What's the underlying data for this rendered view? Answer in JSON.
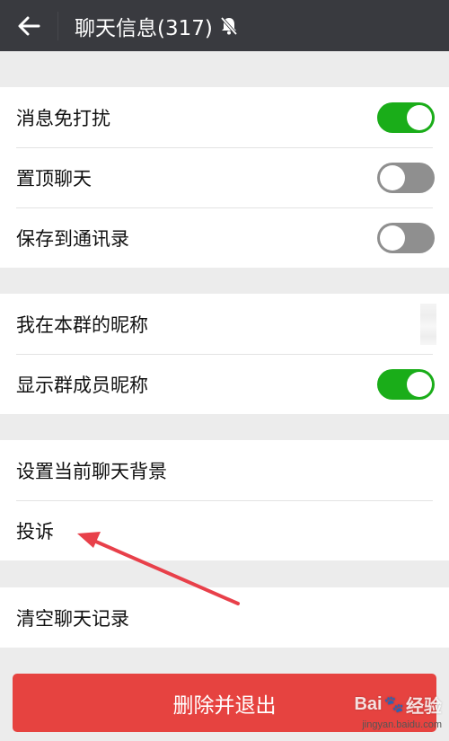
{
  "header": {
    "title": "聊天信息(317)",
    "back_icon": "arrow-left-icon",
    "mute_icon": "bell-muted-icon"
  },
  "groups": [
    {
      "items": [
        {
          "label": "消息免打扰",
          "control": "toggle",
          "state": "on"
        },
        {
          "label": "置顶聊天",
          "control": "toggle",
          "state": "off"
        },
        {
          "label": "保存到通讯录",
          "control": "toggle",
          "state": "off"
        }
      ]
    },
    {
      "items": [
        {
          "label": "我在本群的昵称",
          "control": "value",
          "value": ""
        },
        {
          "label": "显示群成员昵称",
          "control": "toggle",
          "state": "on"
        }
      ]
    },
    {
      "items": [
        {
          "label": "设置当前聊天背景"
        },
        {
          "label": "投诉"
        }
      ]
    },
    {
      "items": [
        {
          "label": "清空聊天记录"
        }
      ]
    }
  ],
  "delete_button": {
    "label": "删除并退出"
  },
  "watermark": {
    "brand": "Bai",
    "brand_suffix": "经验",
    "url": "jingyan.baidu.com"
  },
  "colors": {
    "header_bg": "#393a3f",
    "toggle_on": "#1aad19",
    "toggle_off": "#8f8f8f",
    "danger": "#e64340",
    "annotation_arrow": "#e8404a"
  }
}
